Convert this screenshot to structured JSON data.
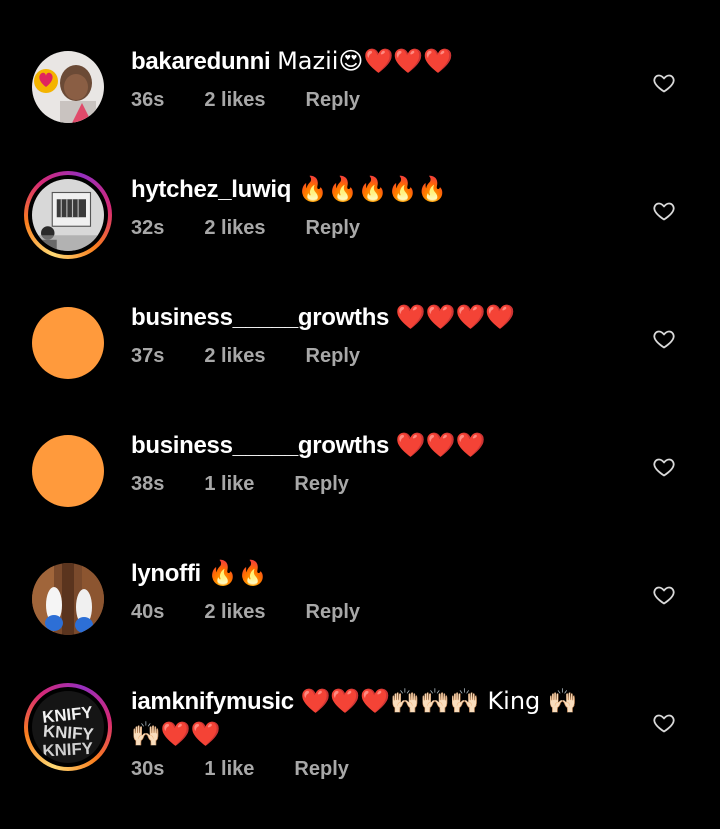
{
  "comments": [
    {
      "username": "bakaredunni",
      "text": "Mazii😍❤️❤️❤️",
      "time": "36s",
      "likes": "2 likes",
      "reply": "Reply",
      "avatar": {
        "type": "photo",
        "ring": false
      }
    },
    {
      "username": "hytchez_luwiq",
      "text": "🔥🔥🔥🔥🔥",
      "time": "32s",
      "likes": "2 likes",
      "reply": "Reply",
      "avatar": {
        "type": "photo",
        "ring": true
      }
    },
    {
      "username": "business_____growths",
      "text": "❤️❤️❤️❤️",
      "time": "37s",
      "likes": "2 likes",
      "reply": "Reply",
      "avatar": {
        "type": "solid",
        "color": "#ff9a3c",
        "ring": false
      }
    },
    {
      "username": "business_____growths",
      "text": "❤️❤️❤️",
      "time": "38s",
      "likes": "1 like",
      "reply": "Reply",
      "avatar": {
        "type": "solid",
        "color": "#ff9a3c",
        "ring": false
      }
    },
    {
      "username": "lynoffi",
      "text": "🔥🔥",
      "time": "40s",
      "likes": "2 likes",
      "reply": "Reply",
      "avatar": {
        "type": "photo",
        "ring": false
      }
    },
    {
      "username": "iamknifymusic",
      "text": "❤️❤️❤️🙌🏻🙌🏻🙌🏻 King 🙌🏻🙌🏻❤️❤️",
      "time": "30s",
      "likes": "1 like",
      "reply": "Reply",
      "avatar": {
        "type": "logo",
        "ring": true,
        "logo_text": "KNIFY"
      }
    }
  ],
  "icons": {
    "like": "heart-outline-icon"
  },
  "colors": {
    "background": "#000000",
    "text": "#ffffff",
    "meta": "#a8a8a8",
    "accent_orange": "#ff9a3c"
  }
}
